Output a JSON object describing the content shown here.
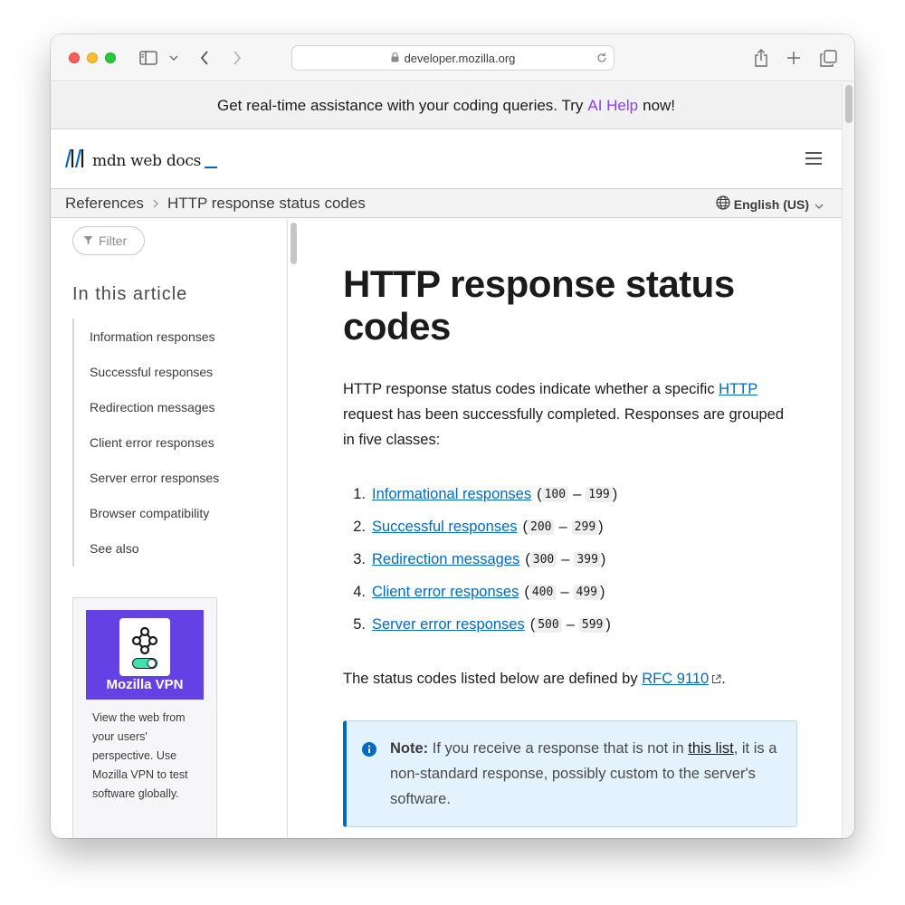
{
  "browser": {
    "url": "developer.mozilla.org"
  },
  "banner": {
    "text_before": "Get real-time assistance with your coding queries. Try",
    "ai_link": "AI Help",
    "text_after": "now!"
  },
  "header": {
    "logo_text": "mdn web docs"
  },
  "breadcrumb": {
    "parent": "References",
    "current": "HTTP response status codes",
    "language": "English (US)"
  },
  "sidebar": {
    "filter_placeholder": "Filter",
    "toc_title": "In this article",
    "toc_items": [
      "Information responses",
      "Successful responses",
      "Redirection messages",
      "Client error responses",
      "Server error responses",
      "Browser compatibility",
      "See also"
    ],
    "promo": {
      "name": "Mozilla VPN",
      "text": "View the web from your users' perspective. Use Mozilla VPN to test software globally."
    }
  },
  "main": {
    "title": "HTTP response status codes",
    "intro_before": "HTTP response status codes indicate whether a specific",
    "intro_link": "HTTP",
    "intro_after": "request has been successfully completed. Responses are grouped in five classes:",
    "classes": [
      {
        "num": "1.",
        "label": "Informational responses",
        "from": "100",
        "to": "199"
      },
      {
        "num": "2.",
        "label": "Successful responses",
        "from": "200",
        "to": "299"
      },
      {
        "num": "3.",
        "label": "Redirection messages",
        "from": "300",
        "to": "399"
      },
      {
        "num": "4.",
        "label": "Client error responses",
        "from": "400",
        "to": "499"
      },
      {
        "num": "5.",
        "label": "Server error responses",
        "from": "500",
        "to": "599"
      }
    ],
    "defined_before": "The status codes listed below are defined by",
    "defined_link": "RFC 9110",
    "defined_after": ".",
    "note": {
      "label": "Note:",
      "text_before": "If you receive a response that is not in",
      "link": "this list",
      "text_after": ", it is a non-standard response, possibly custom to the server's software."
    }
  },
  "colors": {
    "link": "#0069c2",
    "ai_help": "#8a3ffc",
    "note_bg": "#e4f2fd",
    "promo_bg": "#6441e5"
  }
}
